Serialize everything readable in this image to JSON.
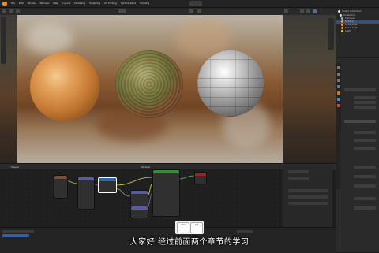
{
  "topbar": {
    "menu": [
      "File",
      "Edit",
      "Render",
      "Window",
      "Help",
      "Layout",
      "Modeling",
      "Sculpting",
      "UV Editing",
      "Texture Paint",
      "Shading"
    ],
    "active_workspace": "Shading"
  },
  "outliner": {
    "rows": [
      {
        "label": "Scene Collection",
        "color": "#dddddd"
      },
      {
        "label": "Collection",
        "color": "#dddddd"
      },
      {
        "label": "Camera",
        "color": "#8fb7e8"
      },
      {
        "label": "Sphere",
        "color": "#f0a24a"
      },
      {
        "label": "Sphere.001",
        "color": "#f0a24a"
      },
      {
        "label": "Sphere.002",
        "color": "#f0a24a"
      },
      {
        "label": "Light",
        "color": "#e8d84a"
      }
    ],
    "highlight_index": 3
  },
  "node_editor": {
    "header_label": "Object",
    "slot_label": "Material",
    "nodes": [
      {
        "title": "Texture Coordinate",
        "header_color": "#8a4a2a"
      },
      {
        "title": "Mapping",
        "header_color": "#5a5aa0"
      },
      {
        "title": "Image Texture",
        "header_color": "#2f6aa8"
      },
      {
        "title": "Color Ramp",
        "header_color": "#5a5aa0"
      },
      {
        "title": "Bump",
        "header_color": "#5a5aa0"
      },
      {
        "title": "Principled BSDF",
        "header_color": "#3a8a3a"
      },
      {
        "title": "Material Output",
        "header_color": "#8a2a2a"
      }
    ]
  },
  "subtitle": "大家好 经过前面两个章节的学习",
  "tooltip": {
    "key_left": "Ctrl",
    "key_right": "Alt"
  },
  "colors": {
    "accent": "#e88a2b",
    "selection": "#3a4f73",
    "node_selected": "#2f6aa8"
  }
}
